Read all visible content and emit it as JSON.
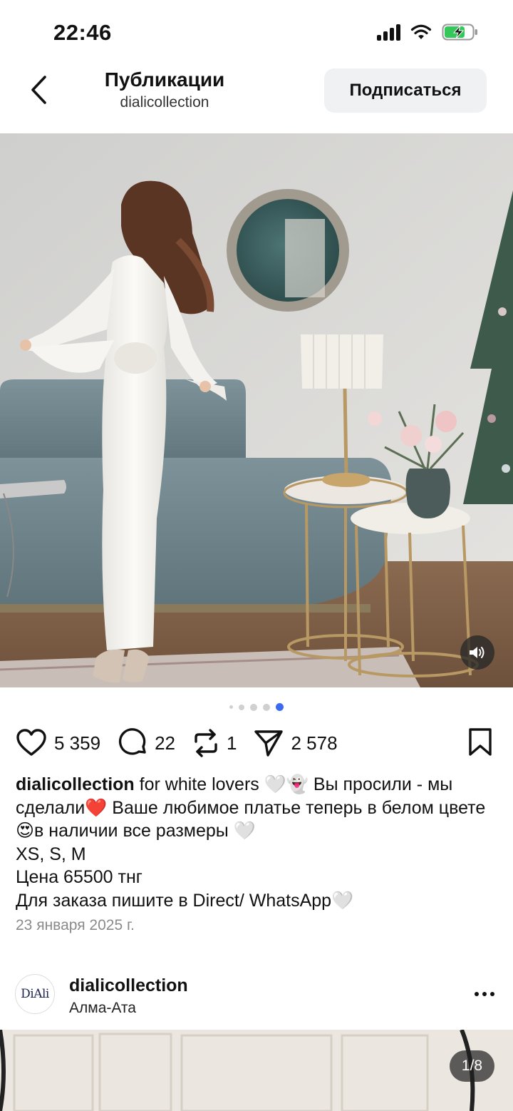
{
  "status_bar": {
    "time": "22:46"
  },
  "header": {
    "title": "Публикации",
    "subtitle": "dialicollection",
    "follow_label": "Подписаться"
  },
  "carousel": {
    "total_slides": 5,
    "active_index": 4
  },
  "actions": {
    "likes": "5 359",
    "comments": "22",
    "reposts": "1",
    "shares": "2 578"
  },
  "caption": {
    "username": "dialicollection",
    "line1": " for white lovers 🤍👻 Вы просили - мы сделали❤️ Ваше любимое платье теперь в белом цвете 😍в наличии все размеры 🤍",
    "sizes": "XS, S, M",
    "price": "Цена 65500 тнг",
    "order": "Для заказа пишите в Direct/ WhatsApp🤍"
  },
  "date": "23 января 2025 г.",
  "next_post": {
    "username": "dialicollection",
    "location": "Алма-Ата",
    "avatar_text": "DiAli",
    "slide_counter": "1/8"
  },
  "colors": {
    "accent_dot": "#3d6bf0",
    "follow_bg": "#eff1f3"
  }
}
